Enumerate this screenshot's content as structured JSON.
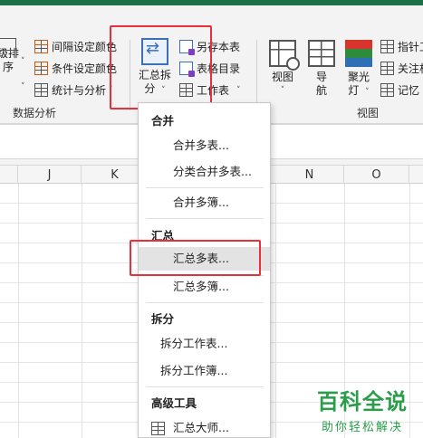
{
  "ribbon": {
    "partial_left_button": {
      "line1": "级排",
      "line2": "序"
    },
    "partial_left_carets": [
      "˅",
      "˅"
    ],
    "data_analysis": {
      "items": [
        {
          "label": "间隔设定颜色",
          "icon": "interval-color-icon"
        },
        {
          "label": "条件设定颜色",
          "icon": "condition-color-icon"
        },
        {
          "label": "统计与分析",
          "icon": "statistics-icon"
        }
      ],
      "group_label": "数据分析"
    },
    "merge_split": {
      "line1": "汇总拆",
      "line2": "分",
      "caret": "˅"
    },
    "small_items": [
      {
        "label": "另存本表",
        "icon": "save-as-sheet-icon"
      },
      {
        "label": "表格目录",
        "icon": "table-catalog-icon"
      },
      {
        "label": "工作表",
        "icon": "worksheet-icon"
      }
    ],
    "view": {
      "buttons": [
        {
          "line1": "视图",
          "line2": "˅"
        },
        {
          "line1": "导",
          "line2": "航"
        },
        {
          "line1": "聚光",
          "line2": "灯"
        }
      ],
      "small_items": [
        {
          "label": "指针工",
          "icon": "pointer-tool-icon"
        },
        {
          "label": "关注相",
          "icon": "focus-icon"
        },
        {
          "label": "记忆",
          "icon": "memory-icon"
        }
      ],
      "group_label": "视图"
    }
  },
  "grid": {
    "columns": [
      "J",
      "K",
      "N",
      "O"
    ]
  },
  "menu": {
    "sections": [
      {
        "header": "合并",
        "items": [
          "合并多表...",
          "分类合并多表...",
          "合并多簿..."
        ]
      },
      {
        "header": "汇总",
        "items": [
          "汇总多表...",
          "汇总多簿..."
        ]
      },
      {
        "header": "拆分",
        "items": [
          "拆分工作表...",
          "拆分工作簿..."
        ]
      },
      {
        "header": "高级工具",
        "items": [
          "汇总大师..."
        ]
      }
    ],
    "highlighted": "汇总多表..."
  },
  "watermark": {
    "title": "百科全说",
    "subtitle": "助你轻松解决"
  },
  "colors": {
    "accent": "#1e7145",
    "highlight_box": "#e8303a",
    "watermark": "#2a9d4a"
  }
}
